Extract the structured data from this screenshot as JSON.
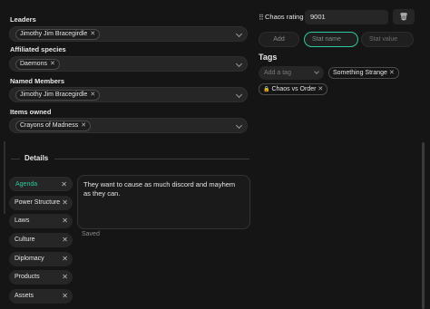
{
  "form": {
    "leaders_label": "Leaders",
    "leaders_chip": "Jimothy Jim Bracegirdle",
    "species_label": "Affiliated species",
    "species_chip": "Daemons",
    "members_label": "Named Members",
    "members_chip": "Jimothy Jim Bracegirdle",
    "items_label": "Items owned",
    "items_chip": "Crayons of Madness"
  },
  "stats": {
    "label": "Chaos rating",
    "value": "9001",
    "add_label": "Add",
    "name_placeholder": "Stat name",
    "value_placeholder": "Stat value"
  },
  "tags": {
    "heading": "Tags",
    "add_placeholder": "Add a tag",
    "items": [
      "Something Strange",
      "Chaos vs Order"
    ]
  },
  "details": {
    "heading": "Details",
    "sections": [
      "Agenda",
      "Power Structure",
      "Laws",
      "Culture",
      "Diplomacy",
      "Products",
      "Assets"
    ],
    "active": "Agenda",
    "text": "They want to cause as much discord and mayhem as they can.",
    "status": "Saved"
  },
  "colors": {
    "background": "#151515",
    "accent": "#2fc9a0",
    "chip_border": "#4a4a4a"
  }
}
